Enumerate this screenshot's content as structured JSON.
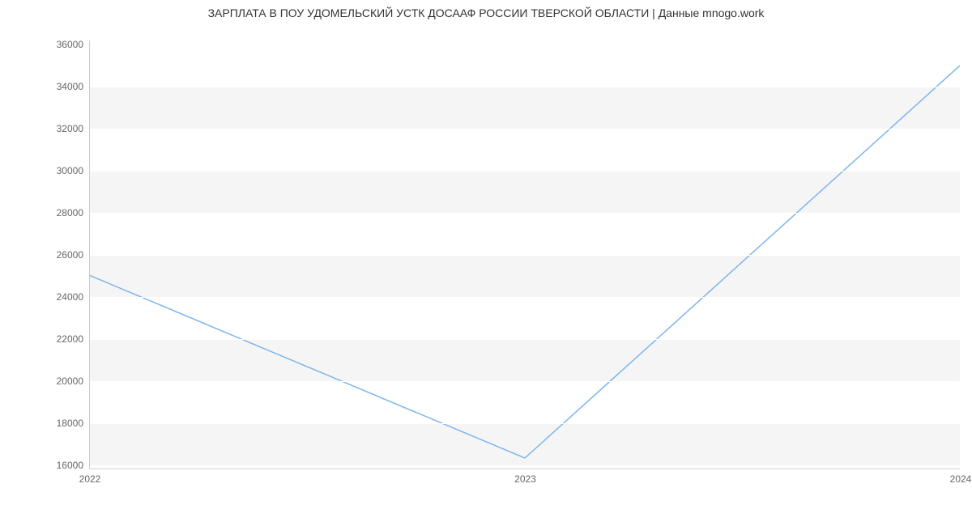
{
  "chart_data": {
    "type": "line",
    "title": "ЗАРПЛАТА В ПОУ УДОМЕЛЬСКИЙ УСТК ДОСААФ РОССИИ ТВЕРСКОЙ ОБЛАСТИ | Данные mnogo.work",
    "xlabel": "",
    "ylabel": "",
    "x": [
      "2022",
      "2023",
      "2024"
    ],
    "values": [
      25000,
      16300,
      35000
    ],
    "y_ticks": [
      16000,
      18000,
      20000,
      22000,
      24000,
      26000,
      28000,
      30000,
      32000,
      34000,
      36000
    ],
    "ylim": [
      15800,
      36200
    ],
    "line_color": "#7cb5ec"
  }
}
